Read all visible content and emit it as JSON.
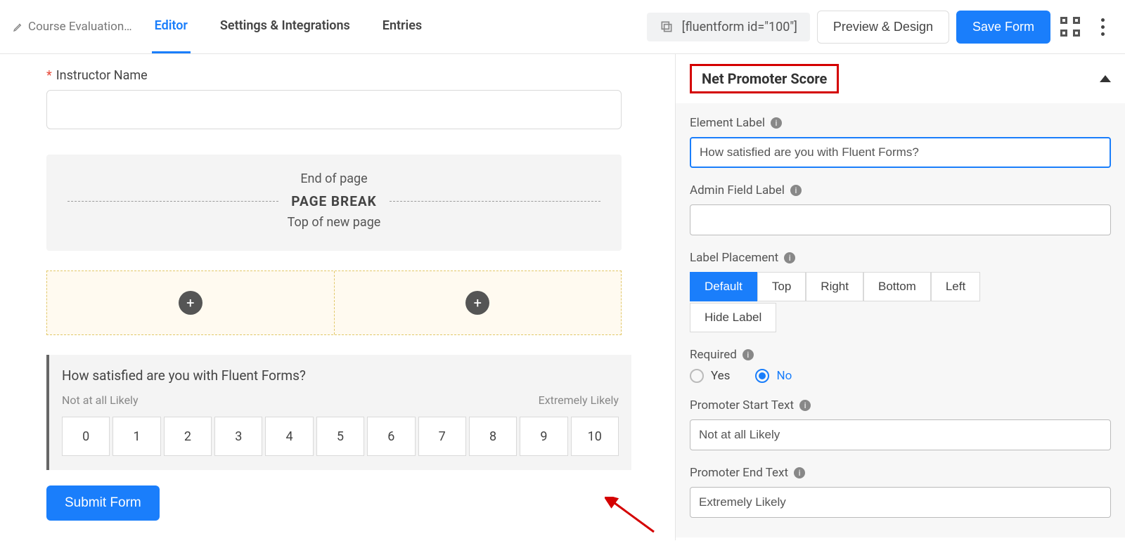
{
  "header": {
    "form_name": "Course Evaluation…",
    "tabs": {
      "editor": "Editor",
      "settings": "Settings & Integrations",
      "entries": "Entries"
    },
    "shortcode": "[fluentform id=\"100\"]",
    "preview_btn": "Preview & Design",
    "save_btn": "Save Form"
  },
  "canvas": {
    "instructor_label": "Instructor Name",
    "pagebreak": {
      "end": "End of page",
      "title": "PAGE BREAK",
      "top": "Top of new page"
    },
    "nps": {
      "question": "How satisfied are you with Fluent Forms?",
      "start": "Not at all Likely",
      "end": "Extremely Likely",
      "values": [
        "0",
        "1",
        "2",
        "3",
        "4",
        "5",
        "6",
        "7",
        "8",
        "9",
        "10"
      ]
    },
    "submit": "Submit Form"
  },
  "panel": {
    "title": "Net Promoter Score",
    "element_label": {
      "label": "Element Label",
      "value": "How satisfied are you with Fluent Forms?"
    },
    "admin_label": {
      "label": "Admin Field Label",
      "value": ""
    },
    "placement": {
      "label": "Label Placement",
      "options": [
        "Default",
        "Top",
        "Right",
        "Bottom",
        "Left",
        "Hide Label"
      ],
      "selected": "Default"
    },
    "required": {
      "label": "Required",
      "yes": "Yes",
      "no": "No",
      "value": "No"
    },
    "start_text": {
      "label": "Promoter Start Text",
      "value": "Not at all Likely"
    },
    "end_text": {
      "label": "Promoter End Text",
      "value": "Extremely Likely"
    }
  }
}
